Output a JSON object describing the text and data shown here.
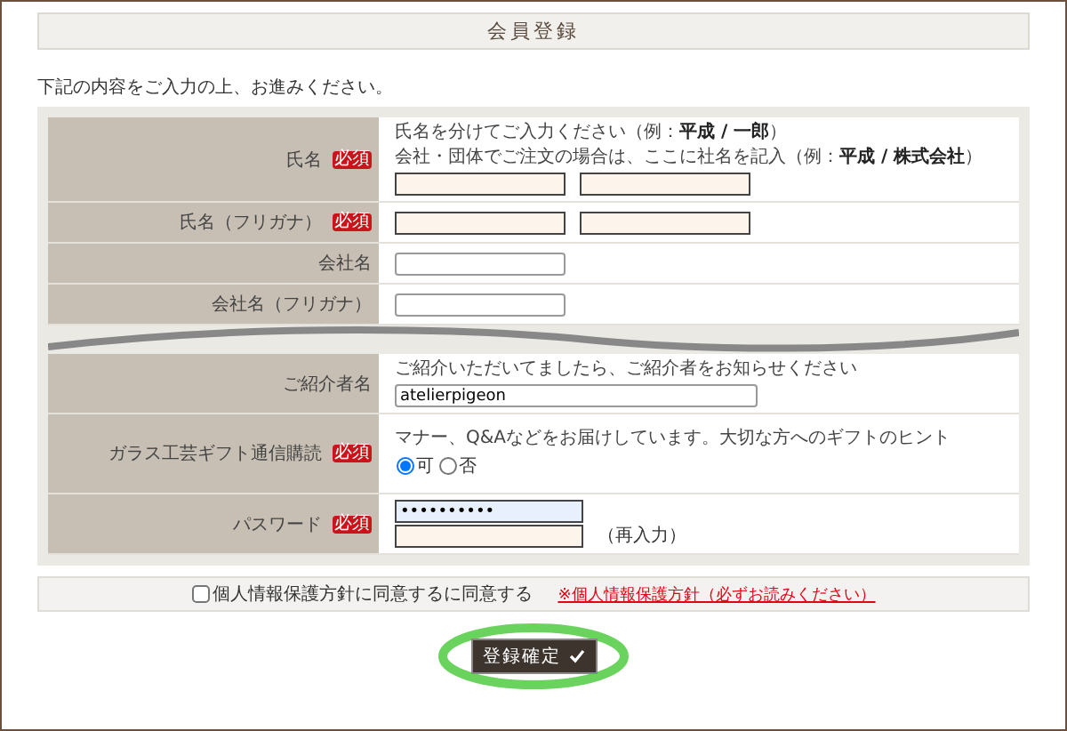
{
  "title": "会員登録",
  "intro": "下記の内容をご入力の上、お進みください。",
  "fields": [
    {
      "kind": "text",
      "label": "氏名",
      "badge": "必須",
      "hints": [
        "氏名を分けてご入力ください（例：**平成 / 一郎**）",
        "会社・団体でご注文の場合は、ここに社名を記入（例：**平成 / 株式会社**）"
      ],
      "inputs": [
        {
          "focused": false
        },
        {
          "focused": false
        }
      ]
    },
    {
      "kind": "text",
      "label": "氏名（フリガナ）",
      "badge": "必須",
      "inputs": [
        {
          "focused": false
        },
        {
          "focused": false
        }
      ]
    },
    {
      "kind": "text",
      "label": "会社名",
      "inputs": [
        {
          "focused": false
        }
      ]
    },
    {
      "kind": "text",
      "label": "会社名（フリガナ）",
      "inputs": [
        {
          "focused": false
        }
      ]
    },
    {
      "kind": "tear"
    },
    {
      "kind": "wide",
      "label": "ご紹介者名",
      "hints": [
        "ご紹介いただいてましたら、ご紹介者をお知らせください"
      ],
      "inputs": [
        {
          "value": "atelierpigeon",
          "focused": false
        }
      ]
    },
    {
      "kind": "radio",
      "label": "ガラス工芸ギフト通信購読",
      "badge": "必須",
      "hints": [
        "マナー、Q&Aなどをお届けしています。大切な方へのギフトのヒント"
      ],
      "options": [
        {
          "label": "可",
          "selected": true
        },
        {
          "label": "否",
          "selected": false
        }
      ]
    },
    {
      "kind": "password",
      "label": "パスワード",
      "badge": "必須",
      "inputs": [
        {
          "value": "••••••••••",
          "focused": true
        },
        {
          "focused": false
        }
      ],
      "note": "（再入力）"
    }
  ],
  "agreement": {
    "checked": false,
    "label": "個人情報保護方針に同意するに同意する",
    "link": "※個人情報保護方針（必ずお読みください）"
  },
  "submit": {
    "label": "登録確定"
  }
}
